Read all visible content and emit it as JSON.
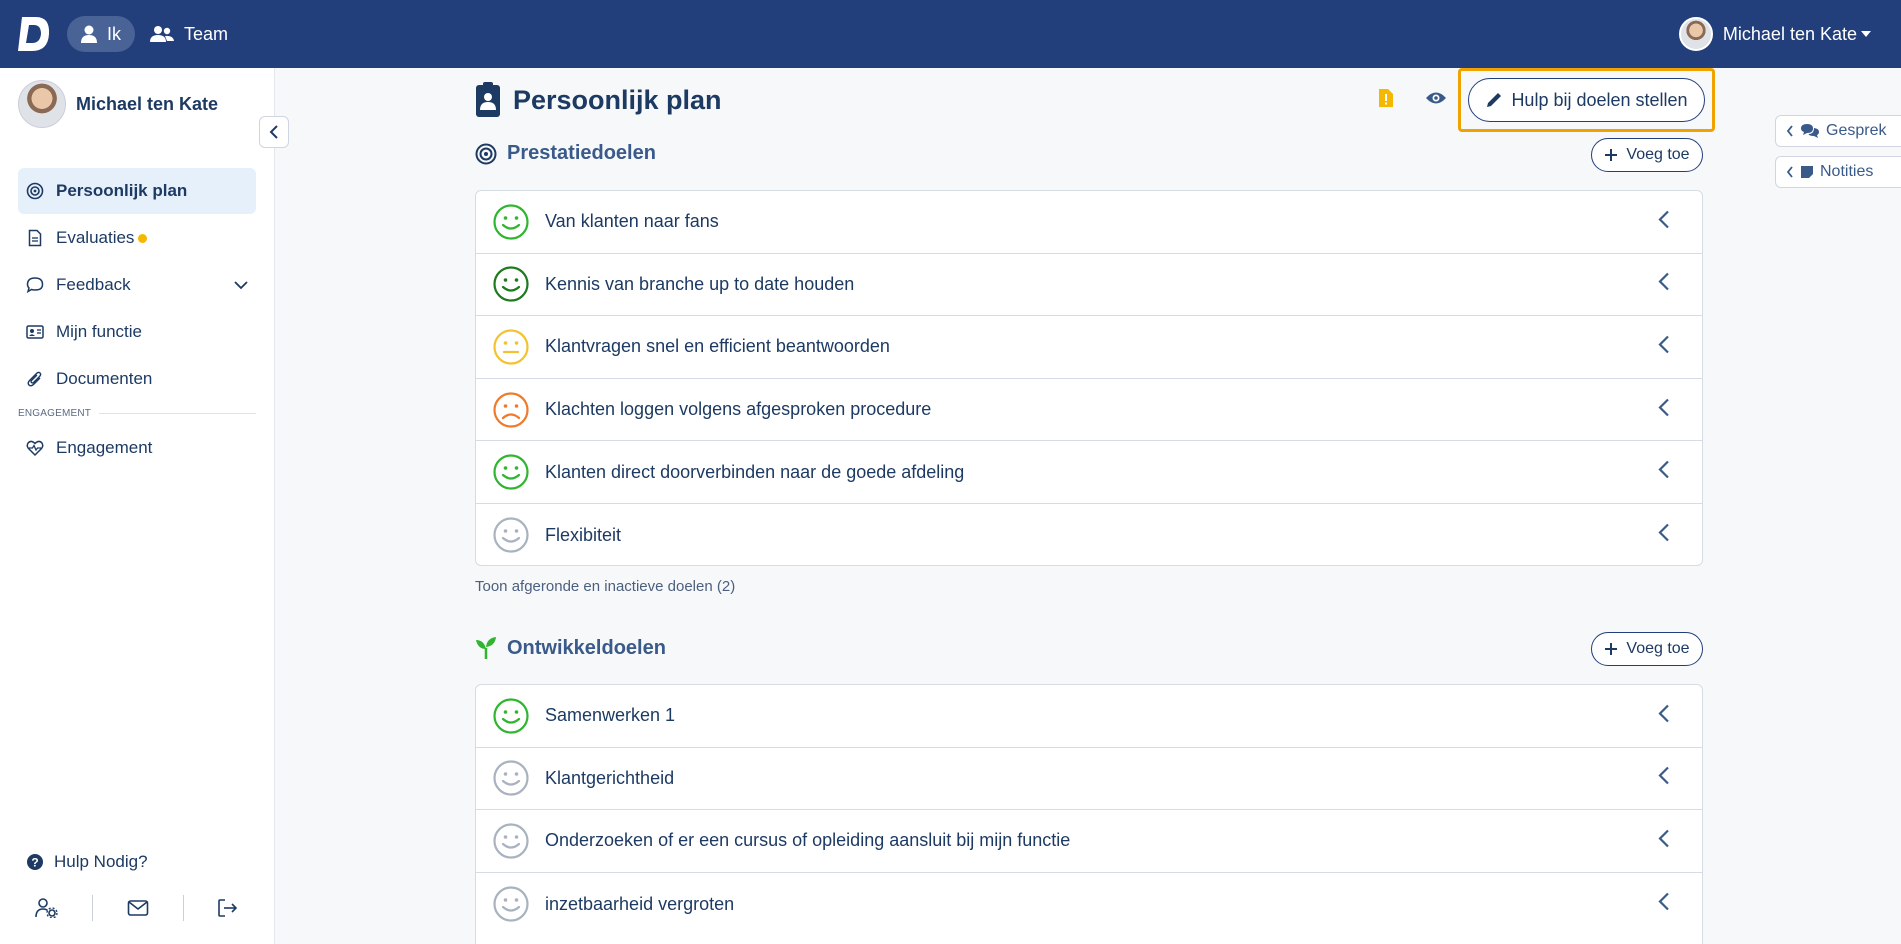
{
  "topbar": {
    "nav_me": "Ik",
    "nav_team": "Team",
    "user_name": "Michael ten Kate"
  },
  "sidebar": {
    "profile_name": "Michael ten Kate",
    "items": [
      {
        "label": "Persoonlijk plan",
        "icon": "target-icon",
        "active": true
      },
      {
        "label": "Evaluaties",
        "icon": "document-icon",
        "badge": "yellow-dot"
      },
      {
        "label": "Feedback",
        "icon": "chat-bubble-icon",
        "expandable": true
      },
      {
        "label": "Mijn functie",
        "icon": "id-card-icon"
      },
      {
        "label": "Documenten",
        "icon": "paperclip-icon"
      }
    ],
    "section_engagement": "ENGAGEMENT",
    "engagement_item": {
      "label": "Engagement",
      "icon": "heart-pulse-icon"
    },
    "help_label": "Hulp Nodig?",
    "bottom_icons": [
      "user-settings-icon",
      "mail-icon",
      "logout-icon"
    ]
  },
  "main": {
    "title": "Persoonlijk plan",
    "help_goals_button": "Hulp bij doelen stellen",
    "performance": {
      "heading": "Prestatiedoelen",
      "add_label": "Voeg toe",
      "goals": [
        {
          "label": "Van klanten naar fans",
          "status": "happy",
          "color": "#2fb52f"
        },
        {
          "label": "Kennis van branche up to date houden",
          "status": "happy",
          "color": "#1d7a1d"
        },
        {
          "label": "Klantvragen snel en efficient beantwoorden",
          "status": "neutral",
          "color": "#f2c230"
        },
        {
          "label": "Klachten loggen volgens afgesproken procedure",
          "status": "sad",
          "color": "#ef7a2b"
        },
        {
          "label": "Klanten direct doorverbinden naar de goede afdeling",
          "status": "happy",
          "color": "#2fb52f"
        },
        {
          "label": "Flexibiteit",
          "status": "none",
          "color": "#a9b2bf"
        }
      ],
      "show_more": "Toon afgeronde en inactieve doelen (2)"
    },
    "development": {
      "heading": "Ontwikkeldoelen",
      "add_label": "Voeg toe",
      "goals": [
        {
          "label": "Samenwerken 1",
          "status": "happy",
          "color": "#2fb52f"
        },
        {
          "label": "Klantgerichtheid",
          "status": "none",
          "color": "#a9b2bf"
        },
        {
          "label": "Onderzoeken of er een cursus of opleiding aansluit bij mijn functie",
          "status": "none",
          "color": "#a9b2bf"
        },
        {
          "label": "inzetbaarheid vergroten",
          "status": "none",
          "color": "#a9b2bf"
        }
      ]
    }
  },
  "right_tabs": {
    "conversation": "Gesprek",
    "notes": "Notities"
  },
  "colors": {
    "topbar": "#223f7b",
    "highlight": "#f0a200",
    "active_bg": "#e6f0fb"
  }
}
